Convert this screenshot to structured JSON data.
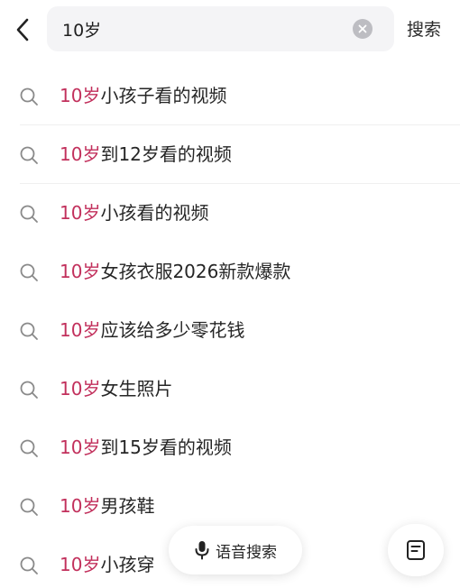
{
  "search": {
    "query": "10岁",
    "submit_label": "搜索"
  },
  "highlight_color": "#c2305c",
  "suggestions": [
    {
      "prefix": "10岁",
      "rest": "小孩子看的视频"
    },
    {
      "prefix": "10岁",
      "rest": "到12岁看的视频"
    },
    {
      "prefix": "10岁",
      "rest": "小孩看的视频"
    },
    {
      "prefix": "10岁",
      "rest": "女孩衣服2026新款爆款"
    },
    {
      "prefix": "10岁",
      "rest": "应该给多少零花钱"
    },
    {
      "prefix": "10岁",
      "rest": "女生照片"
    },
    {
      "prefix": "10岁",
      "rest": "到15岁看的视频"
    },
    {
      "prefix": "10岁",
      "rest": "男孩鞋"
    },
    {
      "prefix": "10岁",
      "rest": "小孩穿"
    }
  ],
  "voice_search": {
    "label": "语音搜索",
    "icon": "microphone-icon"
  },
  "note_button": {
    "icon": "note-icon"
  }
}
